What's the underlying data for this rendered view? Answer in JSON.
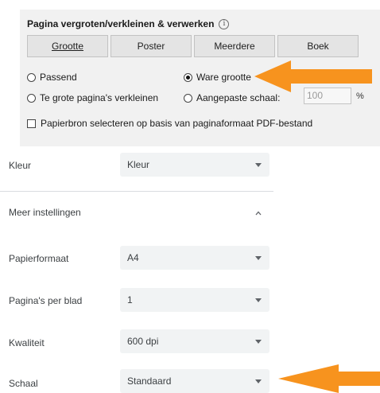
{
  "sizing_panel": {
    "title": "Pagina vergroten/verkleinen & verwerken",
    "info_glyph": "i",
    "mode_buttons": [
      "Grootte",
      "Poster",
      "Meerdere",
      "Boek"
    ],
    "options": {
      "fit": "Passend",
      "actual_size": "Ware grootte",
      "shrink_oversized": "Te grote pagina's verkleinen",
      "custom_scale": "Aangepaste schaal:"
    },
    "custom_scale_value": "100",
    "percent_sign": "%",
    "paper_source_checkbox": "Papierbron selecteren op basis van paginaformaat PDF-bestand"
  },
  "print_settings": {
    "color": {
      "label": "Kleur",
      "value": "Kleur"
    },
    "more_settings": "Meer instellingen",
    "paper_size": {
      "label": "Papierformaat",
      "value": "A4"
    },
    "pages_per_sheet": {
      "label": "Pagina's per blad",
      "value": "1"
    },
    "quality": {
      "label": "Kwaliteit",
      "value": "600 dpi"
    },
    "scale": {
      "label": "Schaal",
      "value": "Standaard"
    }
  },
  "annotation_color": "#f7931e",
  "icons": {
    "info": "info-circle-icon",
    "dropdown": "caret-down-icon",
    "expander": "chevron-up-icon"
  }
}
